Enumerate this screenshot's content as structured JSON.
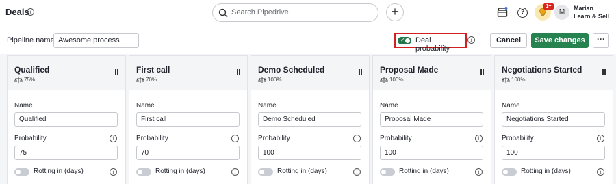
{
  "header": {
    "title": "Deals",
    "search_placeholder": "Search Pipedrive",
    "badge": "1+",
    "avatar_initial": "M",
    "user_name": "Marian",
    "user_company": "Learn & Sell"
  },
  "toolbar": {
    "pipeline_label": "Pipeline name",
    "pipeline_value": "Awesome process",
    "deal_probability_label": "Deal probability",
    "deal_probability_on": true,
    "cancel_label": "Cancel",
    "save_label": "Save changes",
    "more_label": "···"
  },
  "fields": {
    "name_label": "Name",
    "probability_label": "Probability",
    "rotting_label": "Rotting in (days)"
  },
  "stages": [
    {
      "name": "Qualified",
      "percent": "75%",
      "name_value": "Qualified",
      "probability_value": "75"
    },
    {
      "name": "First call",
      "percent": "70%",
      "name_value": "First call",
      "probability_value": "70"
    },
    {
      "name": "Demo Scheduled",
      "percent": "100%",
      "name_value": "Demo Scheduled",
      "probability_value": "100"
    },
    {
      "name": "Proposal Made",
      "percent": "100%",
      "name_value": "Proposal Made",
      "probability_value": "100"
    },
    {
      "name": "Negotiations Started",
      "percent": "100%",
      "name_value": "Negotiations Started",
      "probability_value": "100"
    }
  ],
  "colors": {
    "accent_green": "#26834f",
    "highlight_red": "#d21f1f"
  }
}
